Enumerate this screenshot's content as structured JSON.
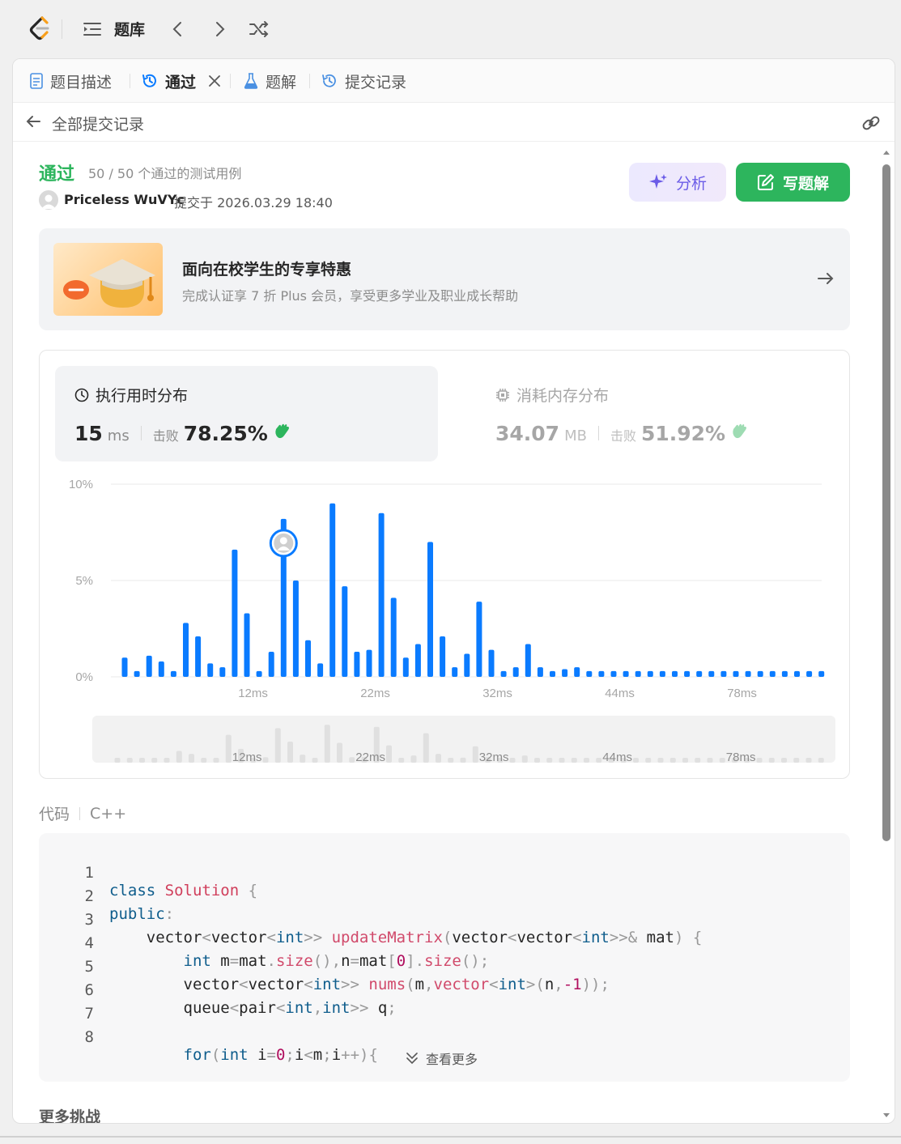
{
  "topbar": {
    "title": "题库"
  },
  "tabs": [
    {
      "label": "题目描述",
      "icon": "document-icon"
    },
    {
      "label": "通过",
      "icon": "history-icon",
      "active": true
    },
    {
      "label": "题解",
      "icon": "flask-icon"
    },
    {
      "label": "提交记录",
      "icon": "history-icon"
    }
  ],
  "subhead": {
    "title": "全部提交记录"
  },
  "submission": {
    "status": "通过",
    "cases": "50 / 50 个通过的测试用例",
    "author": "Priceless WuVYc",
    "submitted_at": "提交于 2026.03.29 18:40"
  },
  "buttons": {
    "analyze": "分析",
    "write_solution": "写题解"
  },
  "promo": {
    "title": "面向在校学生的专享特惠",
    "subtitle": "完成认证享 7 折 Plus 会员，享受更多学业及职业成长帮助"
  },
  "runtime": {
    "label": "执行用时分布",
    "value": "15",
    "unit": "ms",
    "beat_label": "击败",
    "beat_pct": "78.25%"
  },
  "memory": {
    "label": "消耗内存分布",
    "value": "34.07",
    "unit": "MB",
    "beat_label": "击败",
    "beat_pct": "51.92%"
  },
  "chart_data": {
    "type": "bar",
    "ylabel_ticks": [
      "10%",
      "5%",
      "0%"
    ],
    "ylim": [
      0,
      10
    ],
    "x_tick_labels": [
      "12ms",
      "22ms",
      "32ms",
      "44ms",
      "78ms"
    ],
    "x_tick_positions": [
      10.5,
      20.5,
      30.5,
      40.5,
      50.5
    ],
    "values": [
      1.0,
      0.3,
      1.1,
      0.8,
      0.3,
      2.8,
      2.1,
      0.7,
      0.5,
      6.6,
      3.3,
      0.3,
      1.3,
      8.2,
      5.0,
      1.9,
      0.7,
      9.0,
      4.7,
      1.3,
      1.4,
      8.5,
      4.1,
      1.0,
      1.7,
      7.0,
      2.1,
      0.5,
      1.2,
      3.9,
      1.4,
      0.3,
      0.5,
      1.7,
      0.5,
      0.3,
      0.4,
      0.5,
      0.3,
      0.3,
      0.3,
      0.3,
      0.3,
      0.3,
      0.3,
      0.3,
      0.3,
      0.3,
      0.3,
      0.3,
      0.3,
      0.3,
      0.3,
      0.3,
      0.3,
      0.3,
      0.3,
      0.3
    ],
    "highlight_index": 13,
    "bar_color": "#0a7bff",
    "grid": true
  },
  "code": {
    "label": "代码",
    "language": "C++",
    "more_label": "查看更多",
    "lines": [
      "1",
      "2",
      "3",
      "4",
      "5",
      "6",
      "7",
      "8"
    ]
  },
  "more_challenges": "更多挑战",
  "colors": {
    "accent_green": "#2db55d",
    "accent_blue": "#0a7bff",
    "analyze_purple": "#6b5ce7"
  }
}
